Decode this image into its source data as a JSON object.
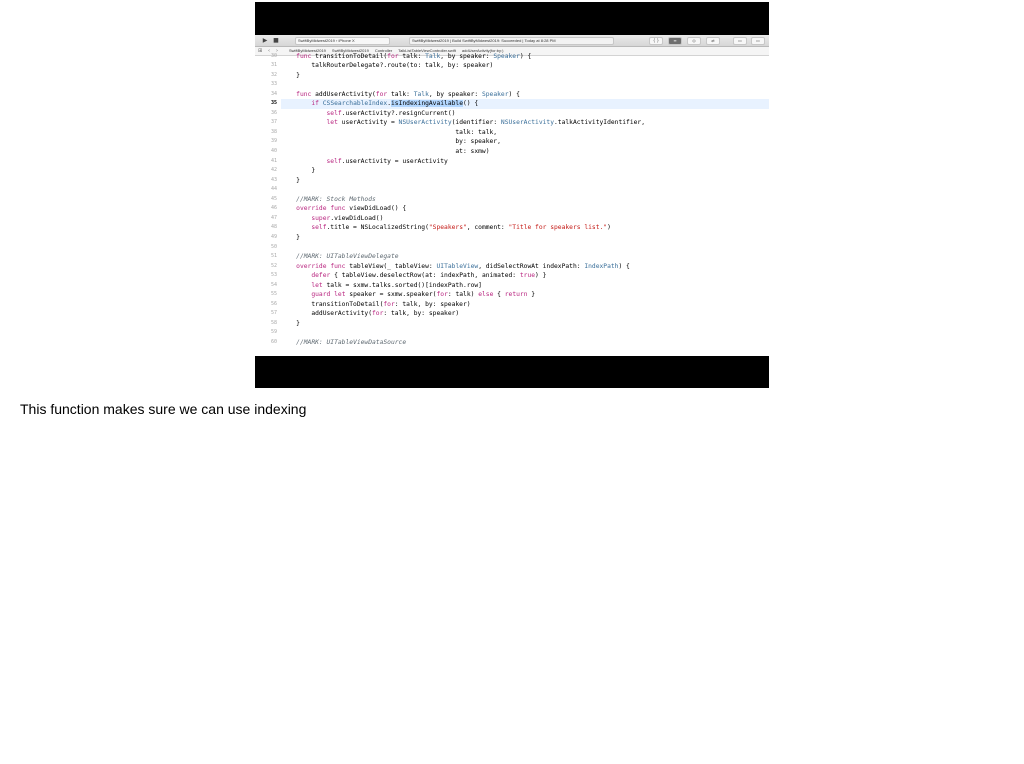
{
  "toolbar": {
    "run_icon": "play-icon",
    "stop_icon": "stop-icon",
    "scheme_label": "SwiftByMidwest2019 › iPhone X",
    "status_label": "SwiftByMidwest2019 | Build SwiftByMidwest2019: Succeeded | Today at 8:28 PM"
  },
  "jumpbar": {
    "crumbs": [
      "SwiftByMidwest2019",
      "SwiftByMidwest2019",
      "Controller",
      "TalkListTableViewController.swift",
      "addUserActivity(for:by:)"
    ]
  },
  "editor": {
    "current_line": 35,
    "lines": [
      {
        "n": "30",
        "text": "    func transitionToDetail(for talk: Talk, by speaker: Speaker) {"
      },
      {
        "n": "31",
        "text": "        talkRouterDelegate?.route(to: talk, by: speaker)"
      },
      {
        "n": "32",
        "text": "    }"
      },
      {
        "n": "33",
        "text": ""
      },
      {
        "n": "34",
        "text": "    func addUserActivity(for talk: Talk, by speaker: Speaker) {"
      },
      {
        "n": "35",
        "text": "        if CSSearchableIndex.isIndexingAvailable() {"
      },
      {
        "n": "36",
        "text": "            self.userActivity?.resignCurrent()"
      },
      {
        "n": "37",
        "text": "            let userActivity = NSUserActivity(identifier: NSUserActivity.talkActivityIdentifier,"
      },
      {
        "n": "38",
        "text": "                                              talk: talk,"
      },
      {
        "n": "39",
        "text": "                                              by: speaker,"
      },
      {
        "n": "40",
        "text": "                                              at: sxmw)"
      },
      {
        "n": "41",
        "text": "            self.userActivity = userActivity"
      },
      {
        "n": "42",
        "text": "        }"
      },
      {
        "n": "43",
        "text": "    }"
      },
      {
        "n": "44",
        "text": ""
      },
      {
        "n": "45",
        "text": "    //MARK: Stock Methods"
      },
      {
        "n": "46",
        "text": "    override func viewDidLoad() {"
      },
      {
        "n": "47",
        "text": "        super.viewDidLoad()"
      },
      {
        "n": "48",
        "text": "        self.title = NSLocalizedString(\"Speakers\", comment: \"Title for speakers list.\")"
      },
      {
        "n": "49",
        "text": "    }"
      },
      {
        "n": "50",
        "text": ""
      },
      {
        "n": "51",
        "text": "    //MARK: UITableViewDelegate"
      },
      {
        "n": "52",
        "text": "    override func tableView(_ tableView: UITableView, didSelectRowAt indexPath: IndexPath) {"
      },
      {
        "n": "53",
        "text": "        defer { tableView.deselectRow(at: indexPath, animated: true) }"
      },
      {
        "n": "54",
        "text": "        let talk = sxmw.talks.sorted()[indexPath.row]"
      },
      {
        "n": "55",
        "text": "        guard let speaker = sxmw.speaker(for: talk) else { return }"
      },
      {
        "n": "56",
        "text": "        transitionToDetail(for: talk, by: speaker)"
      },
      {
        "n": "57",
        "text": "        addUserActivity(for: talk, by: speaker)"
      },
      {
        "n": "58",
        "text": "    }"
      },
      {
        "n": "59",
        "text": ""
      },
      {
        "n": "60",
        "text": "    //MARK: UITableViewDataSource"
      }
    ]
  },
  "caption": "This function makes sure we can use indexing"
}
